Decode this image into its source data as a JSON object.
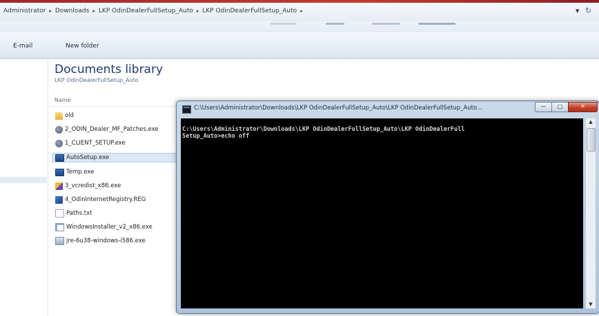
{
  "address": {
    "crumbs": [
      "Administrator",
      "Downloads",
      "LKP OdinDealerFullSetup_Auto",
      "LKP OdinDealerFullSetup_Auto"
    ],
    "separator": "▸",
    "dropdown_icon": "chevron-down-icon",
    "refresh_icon": "refresh-icon"
  },
  "commandbar": {
    "email_label": "E-mail",
    "new_folder_label": "New folder"
  },
  "library": {
    "title": "Documents library",
    "subtitle": "LKP OdinDealerFullSetup_Auto",
    "column_name": "Name"
  },
  "files": [
    {
      "name": "old",
      "icon": "folder-icon"
    },
    {
      "name": "2_ODIN_Dealer_MF_Patches.exe",
      "icon": "setup-icon"
    },
    {
      "name": "1_CLIENT_SETUP.exe",
      "icon": "setup-icon"
    },
    {
      "name": "AutoSetup.exe",
      "icon": "exe-icon",
      "selected": true
    },
    {
      "name": "Temp.exe",
      "icon": "exe-icon"
    },
    {
      "name": "3_vcredist_x86.exe",
      "icon": "vcredist-icon"
    },
    {
      "name": "4_OdinInternetRegistry.REG",
      "icon": "registry-icon"
    },
    {
      "name": "Paths.txt",
      "icon": "text-file-icon"
    },
    {
      "name": "WindowsInstaller_v2_x86.exe",
      "icon": "installer-icon"
    },
    {
      "name": "jre-6u38-windows-i586.exe",
      "icon": "java-installer-icon"
    }
  ],
  "cmd_window": {
    "title": "C:\\Users\\Administrator\\Downloads\\LKP OdinDealerFullSetup_Auto\\LKP OdinDealerFullSetup_Auto...",
    "minimize_glyph": "—",
    "maximize_glyph": "□",
    "close_glyph": "✕",
    "console_lines": [
      "C:\\Users\\Administrator\\Downloads\\LKP OdinDealerFullSetup_Auto\\LKP OdinDealerFull",
      "Setup_Auto>echo off"
    ]
  },
  "colors": {
    "accent_top": "#c73a2e",
    "library_title": "#1e3a6e",
    "console_bg": "#000000",
    "console_text": "#d6d6d6"
  }
}
